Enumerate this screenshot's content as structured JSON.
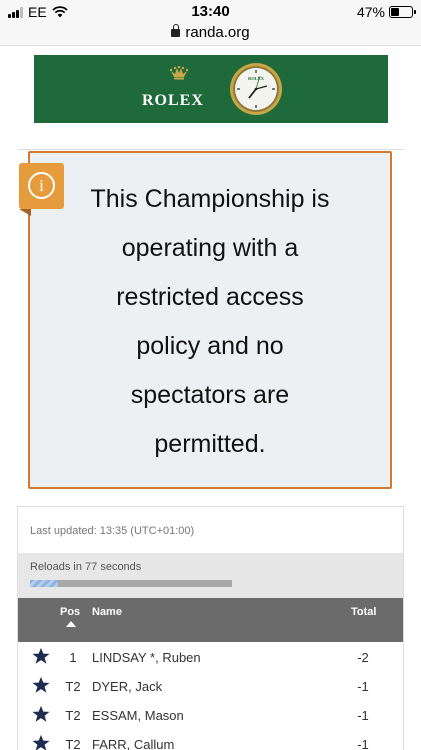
{
  "status_bar": {
    "carrier": "EE",
    "time": "13:40",
    "battery": "47%",
    "battery_level": 0.47
  },
  "browser": {
    "url": "randa.org"
  },
  "banner": {
    "brand": "ROLEX",
    "watch_brand": "ROLEX",
    "background_color": "#1e6a3a",
    "crown_color": "#c9a646"
  },
  "notice": {
    "icon": "info-icon",
    "lines": [
      "This Championship is",
      "operating with a",
      "restricted access",
      "policy and no",
      "spectators are",
      "permitted."
    ],
    "border_color": "#d27a33",
    "icon_color": "#e69b3d"
  },
  "leaderboard": {
    "last_updated": "Last updated: 13:35 (UTC+01:00)",
    "reload_text": "Reloads in 77 seconds",
    "reload_progress": 0.14,
    "headers": {
      "pos": "Pos",
      "name": "Name",
      "total": "Total"
    },
    "rows": [
      {
        "pos": "1",
        "name": "LINDSAY *, Ruben",
        "total": "-2",
        "icon": "star-icon"
      },
      {
        "pos": "T2",
        "name": "DYER, Jack",
        "total": "-1",
        "icon": "star-icon"
      },
      {
        "pos": "T2",
        "name": "ESSAM, Mason",
        "total": "-1",
        "icon": "star-icon"
      },
      {
        "pos": "T2",
        "name": "FARR, Callum",
        "total": "-1",
        "icon": "star-icon"
      }
    ]
  }
}
